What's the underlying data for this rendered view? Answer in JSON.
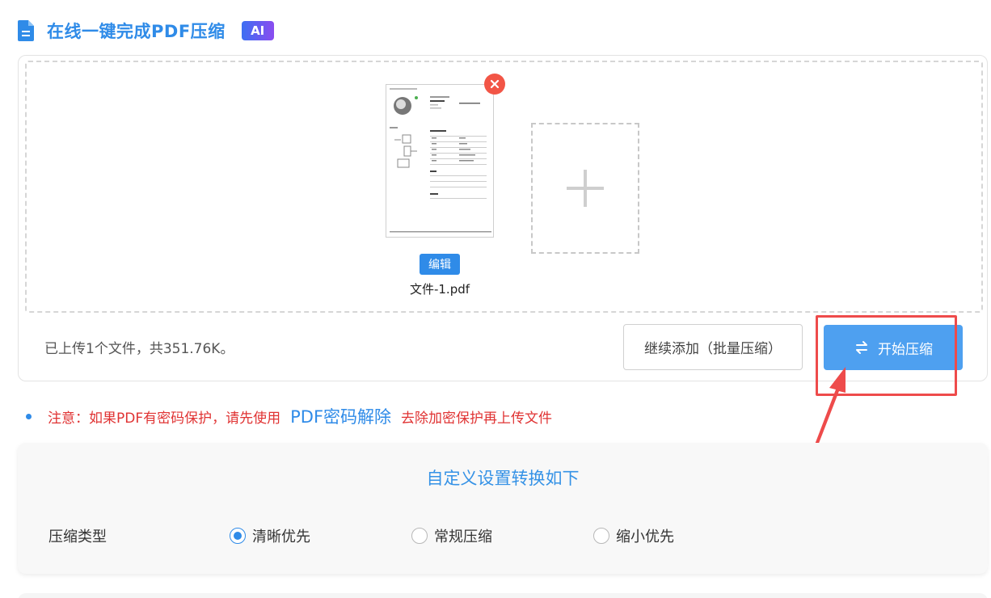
{
  "header": {
    "title": "在线一键完成PDF压缩",
    "ai_badge": "AI",
    "icon": "document-icon",
    "title_color": "#2f8be8"
  },
  "upload": {
    "file_name": "文件-1.pdf",
    "edit_label": "编辑",
    "remove_icon": "close-circle-icon",
    "add_icon": "plus-icon",
    "status_text": "已上传1个文件，共351.76K。",
    "continue_label": "继续添加（批量压缩）",
    "start_label": "开始压缩",
    "start_icon": "swap-arrows-icon"
  },
  "notice": {
    "prefix": "注意：如果PDF有密码保护，请先使用",
    "link": "PDF密码解除",
    "suffix": "去除加密保护再上传文件"
  },
  "settings": {
    "title": "自定义设置转换如下",
    "compression_type_label": "压缩类型",
    "options": [
      {
        "label": "清晰优先",
        "checked": true
      },
      {
        "label": "常规压缩",
        "checked": false
      },
      {
        "label": "缩小优先",
        "checked": false
      }
    ]
  },
  "colors": {
    "accent": "#2f8be8",
    "start_button": "#4ea0f0",
    "warning": "#e03333",
    "annotation": "#ee4b4b"
  }
}
